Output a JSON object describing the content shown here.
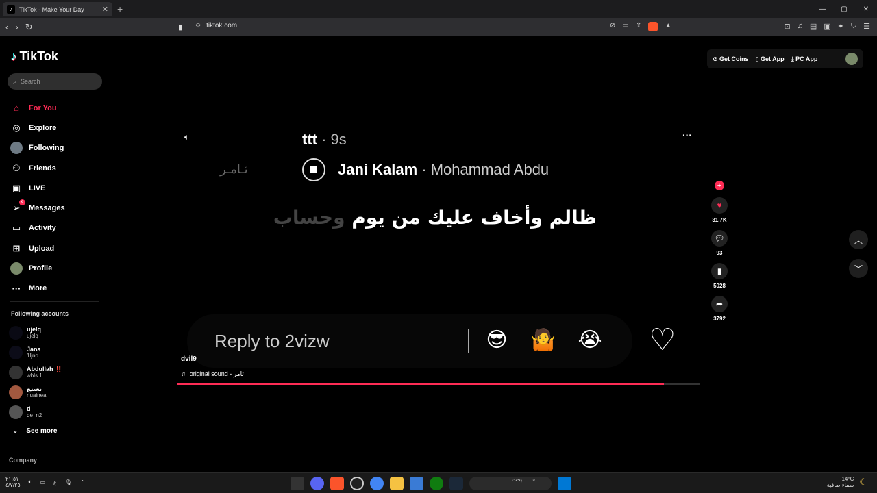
{
  "browser": {
    "tab_title": "TikTok - Make Your Day",
    "url": "tiktok.com"
  },
  "sidebar": {
    "logo": "TikTok",
    "search_placeholder": "Search",
    "items": [
      {
        "label": "For You",
        "icon": "home-icon"
      },
      {
        "label": "Explore",
        "icon": "compass-icon"
      },
      {
        "label": "Following",
        "icon": "avatar"
      },
      {
        "label": "Friends",
        "icon": "friends-icon"
      },
      {
        "label": "LIVE",
        "icon": "live-icon"
      },
      {
        "label": "Messages",
        "icon": "send-icon",
        "badge": "9"
      },
      {
        "label": "Activity",
        "icon": "activity-icon"
      },
      {
        "label": "Upload",
        "icon": "upload-icon"
      },
      {
        "label": "Profile",
        "icon": "avatar"
      },
      {
        "label": "More",
        "icon": "more-icon"
      }
    ],
    "following_title": "Following accounts",
    "accounts": [
      {
        "name": "ujelq",
        "handle": "ujelq"
      },
      {
        "name": "Jana",
        "handle": "1ljno"
      },
      {
        "name": "Abdullah ‼️",
        "handle": "wbls.1"
      },
      {
        "name": "نعيتع",
        "handle": "nuainea"
      },
      {
        "name": "d",
        "handle": "de_n2"
      }
    ],
    "see_more": "See more",
    "company": "Company"
  },
  "topbar": {
    "get_coins": "Get Coins",
    "get_app": "Get App",
    "pc_app": "PC App"
  },
  "video": {
    "title_name": "ttt",
    "title_time": "· 9s",
    "song": "Jani Kalam",
    "artist": "· Mohammad Abdu",
    "signature": "ثـامـر",
    "lyric_main": "ظالم وأخاف عليك من يوم",
    "lyric_dim": "وحساب",
    "reply_placeholder": "Reply to 2vizw",
    "author": "dvil9",
    "sound": "original sound - ثامر",
    "progress": 0.93
  },
  "actions": {
    "likes": "31.7K",
    "comments": "93",
    "saves": "5028",
    "shares": "3792"
  },
  "taskbar": {
    "time": "٢١:٥١",
    "date": "٤/٧/٢٥",
    "lang": "ع",
    "search": "بحث",
    "temp": "14°C",
    "weather": "سماء صافية"
  }
}
